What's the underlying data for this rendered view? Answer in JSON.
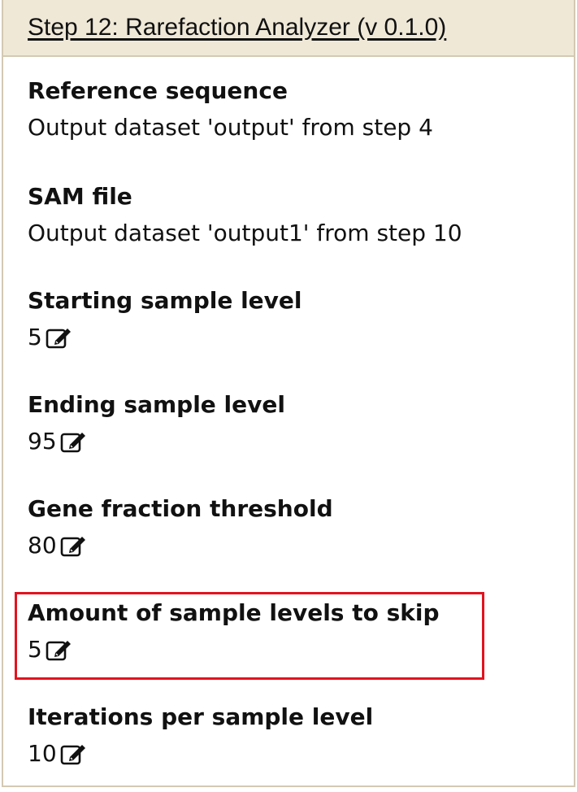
{
  "header": {
    "title": "Step 12: Rarefaction Analyzer (v 0.1.0)"
  },
  "fields": [
    {
      "label": "Reference sequence",
      "value": "Output dataset 'output' from step 4",
      "editable": false
    },
    {
      "label": "SAM file",
      "value": "Output dataset 'output1' from step 10",
      "editable": false
    },
    {
      "label": "Starting sample level",
      "value": "5",
      "editable": true
    },
    {
      "label": "Ending sample level",
      "value": "95",
      "editable": true
    },
    {
      "label": "Gene fraction threshold",
      "value": "80",
      "editable": true
    },
    {
      "label": "Amount of sample levels to skip",
      "value": "5",
      "editable": true,
      "highlighted": true
    },
    {
      "label": "Iterations per sample level",
      "value": "10",
      "editable": true
    }
  ],
  "colors": {
    "header_background": "#efe8d7",
    "panel_border": "#d4c9b3",
    "highlight_border": "#e2131f"
  },
  "icons": {
    "edit": "edit-icon"
  }
}
